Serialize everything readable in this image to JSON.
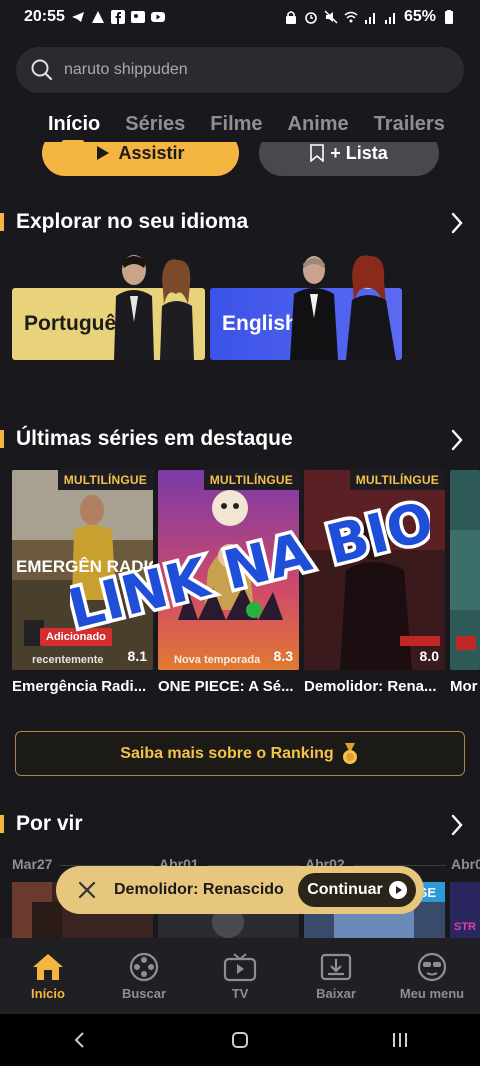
{
  "status_bar": {
    "time": "20:55",
    "battery": "65%"
  },
  "search": {
    "placeholder": "naruto shippuden"
  },
  "tabs": [
    {
      "label": "Início"
    },
    {
      "label": "Séries"
    },
    {
      "label": "Filme"
    },
    {
      "label": "Anime"
    },
    {
      "label": "Trailers"
    }
  ],
  "hero": {
    "watch_label": "Assistir",
    "list_label": "+ Lista"
  },
  "explore": {
    "title": "Explorar no seu idioma",
    "languages": [
      {
        "label": "Português"
      },
      {
        "label": "English"
      }
    ]
  },
  "featured": {
    "title": "Últimas séries em destaque",
    "items": [
      {
        "title": "Emergência Radi...",
        "badge": "MULTILÍNGUE",
        "rating": "8.1",
        "tag": "Adicionado",
        "tag2": "recentemente",
        "poster_text": "EMERGÊN RADIC"
      },
      {
        "title": "ONE PIECE: A Sé...",
        "badge": "MULTILÍNGUE",
        "rating": "8.3",
        "tag2": "Nova temporada"
      },
      {
        "title": "Demolidor: Rena...",
        "badge": "MULTILÍNGUE",
        "rating": "8.0"
      },
      {
        "title": "Mor"
      }
    ]
  },
  "overlay_text": "LINK NA BIO",
  "ranking": {
    "label": "Saiba mais sobre o Ranking"
  },
  "upcoming": {
    "title": "Por vir",
    "dates": [
      "Mar27",
      "Abr01",
      "Abr02",
      "Abr0"
    ],
    "partial_text": "SE",
    "partial_text2": "STR"
  },
  "toast": {
    "title": "Demolidor: Renascido",
    "continue_label": "Continuar"
  },
  "bottom_nav": [
    {
      "label": "Início"
    },
    {
      "label": "Buscar"
    },
    {
      "label": "TV"
    },
    {
      "label": "Baixar"
    },
    {
      "label": "Meu menu"
    }
  ],
  "colors": {
    "accent": "#f4b640",
    "background": "#18181d"
  }
}
